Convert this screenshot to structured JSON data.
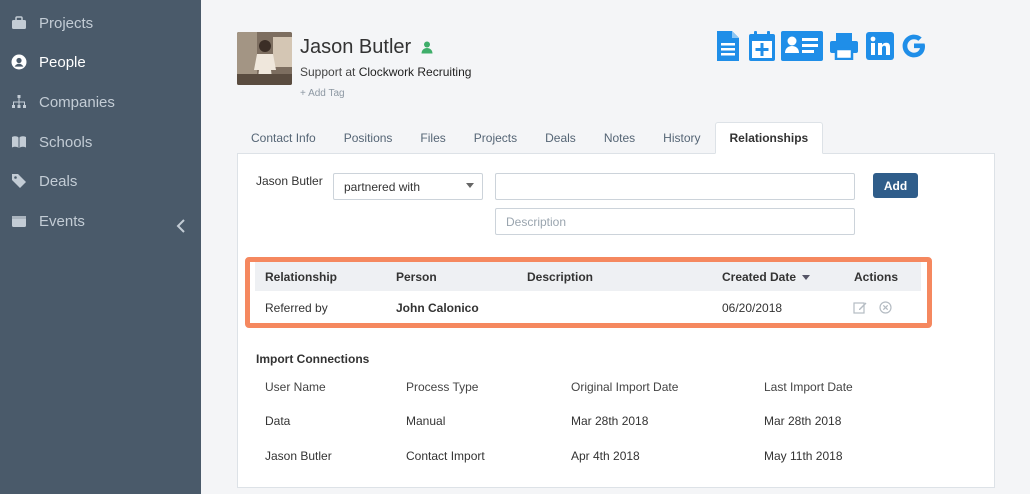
{
  "sidebar": {
    "items": [
      {
        "label": "Projects",
        "icon": "briefcase-icon"
      },
      {
        "label": "People",
        "icon": "person-circle-icon"
      },
      {
        "label": "Companies",
        "icon": "hierarchy-icon"
      },
      {
        "label": "Schools",
        "icon": "book-icon"
      },
      {
        "label": "Deals",
        "icon": "tag-icon"
      },
      {
        "label": "Events",
        "icon": "calendar-icon"
      }
    ],
    "active": "People"
  },
  "profile": {
    "name": "Jason Butler",
    "role_prefix": "Support at",
    "company": "Clockwork Recruiting",
    "add_tag": "+ Add Tag"
  },
  "toolbar": {
    "accent": "#1f8ee8",
    "icons": [
      "document-icon",
      "calendar-add-icon",
      "contact-card-icon",
      "printer-icon",
      "linkedin-icon",
      "google-icon"
    ]
  },
  "tabs": [
    {
      "label": "Contact Info"
    },
    {
      "label": "Positions"
    },
    {
      "label": "Files"
    },
    {
      "label": "Projects"
    },
    {
      "label": "Deals"
    },
    {
      "label": "Notes"
    },
    {
      "label": "History"
    },
    {
      "label": "Relationships"
    }
  ],
  "relationship_form": {
    "subject": "Jason Butler",
    "relation": "partnered with",
    "person_value": "",
    "description_placeholder": "Description",
    "add_label": "Add"
  },
  "relationships": {
    "headers": {
      "relationship": "Relationship",
      "person": "Person",
      "description": "Description",
      "created": "Created Date",
      "actions": "Actions"
    },
    "rows": [
      {
        "relationship": "Referred by",
        "person": "John Calonico",
        "description": "",
        "created": "06/20/2018"
      }
    ]
  },
  "imports": {
    "title": "Import Connections",
    "headers": {
      "user": "User Name",
      "process": "Process Type",
      "original": "Original Import Date",
      "last": "Last Import Date"
    },
    "rows": [
      {
        "user": "Data",
        "process": "Manual",
        "original": "Mar 28th 2018",
        "last": "Mar 28th 2018"
      },
      {
        "user": "Jason Butler",
        "process": "Contact Import",
        "original": "Apr 4th 2018",
        "last": "May 11th 2018"
      }
    ]
  },
  "colors": {
    "sidebar_bg": "#4a5a6a",
    "highlight": "#f5885f",
    "button": "#2f5d8a",
    "status_green": "#3fae6a"
  }
}
